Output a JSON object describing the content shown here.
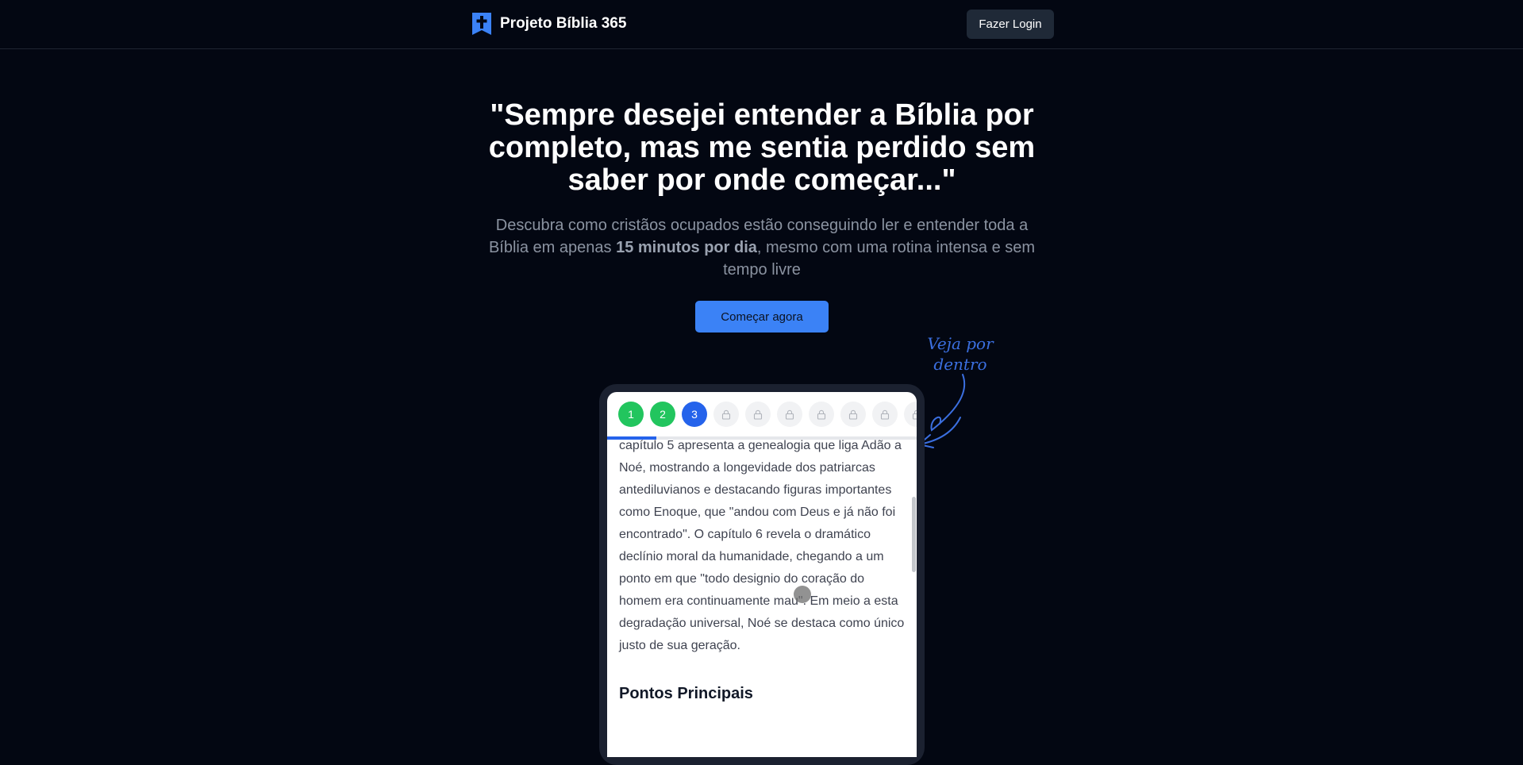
{
  "header": {
    "brand_name": "Projeto Bíblia 365",
    "brand_icon": "cross-book-icon",
    "login_label": "Fazer Login"
  },
  "hero": {
    "title": "\"Sempre desejei entender a Bíblia por completo, mas me sentia perdido sem saber por onde começar...\"",
    "subtitle_before": "Descubra como cristãos ocupados estão conseguindo ler e entender toda a Bíblia em apenas ",
    "subtitle_bold": "15 minutos por dia",
    "subtitle_after": ", mesmo com uma rotina intensa e sem tempo livre",
    "cta_label": "Começar agora"
  },
  "annotation": {
    "text": "Veja por dentro"
  },
  "preview": {
    "steps": [
      {
        "label": "1",
        "state": "done"
      },
      {
        "label": "2",
        "state": "done"
      },
      {
        "label": "3",
        "state": "current"
      },
      {
        "label": "",
        "state": "locked"
      },
      {
        "label": "",
        "state": "locked"
      },
      {
        "label": "",
        "state": "locked"
      },
      {
        "label": "",
        "state": "locked"
      },
      {
        "label": "",
        "state": "locked"
      },
      {
        "label": "",
        "state": "locked"
      },
      {
        "label": "",
        "state": "locked"
      }
    ],
    "progress_fraction": 0.16,
    "reading_text": "capítulo 5 apresenta a genealogia que liga Adão a Noé, mostrando a longevidade dos patriarcas antediluvianos e destacando figuras importantes como Enoque, que \"andou com Deus e já não foi encontrado\". O capítulo 6 revela o dramático declínio moral da humanidade, chegando a um ponto em que \"todo designio do coração do homem era continuamente mau\". Em meio a esta degradação universal, Noé se destaca como único justo de sua geração.",
    "section_title": "Pontos Principais"
  },
  "colors": {
    "background": "#030712",
    "accent": "#3b82f6",
    "done": "#22c55e",
    "current": "#2563eb"
  }
}
